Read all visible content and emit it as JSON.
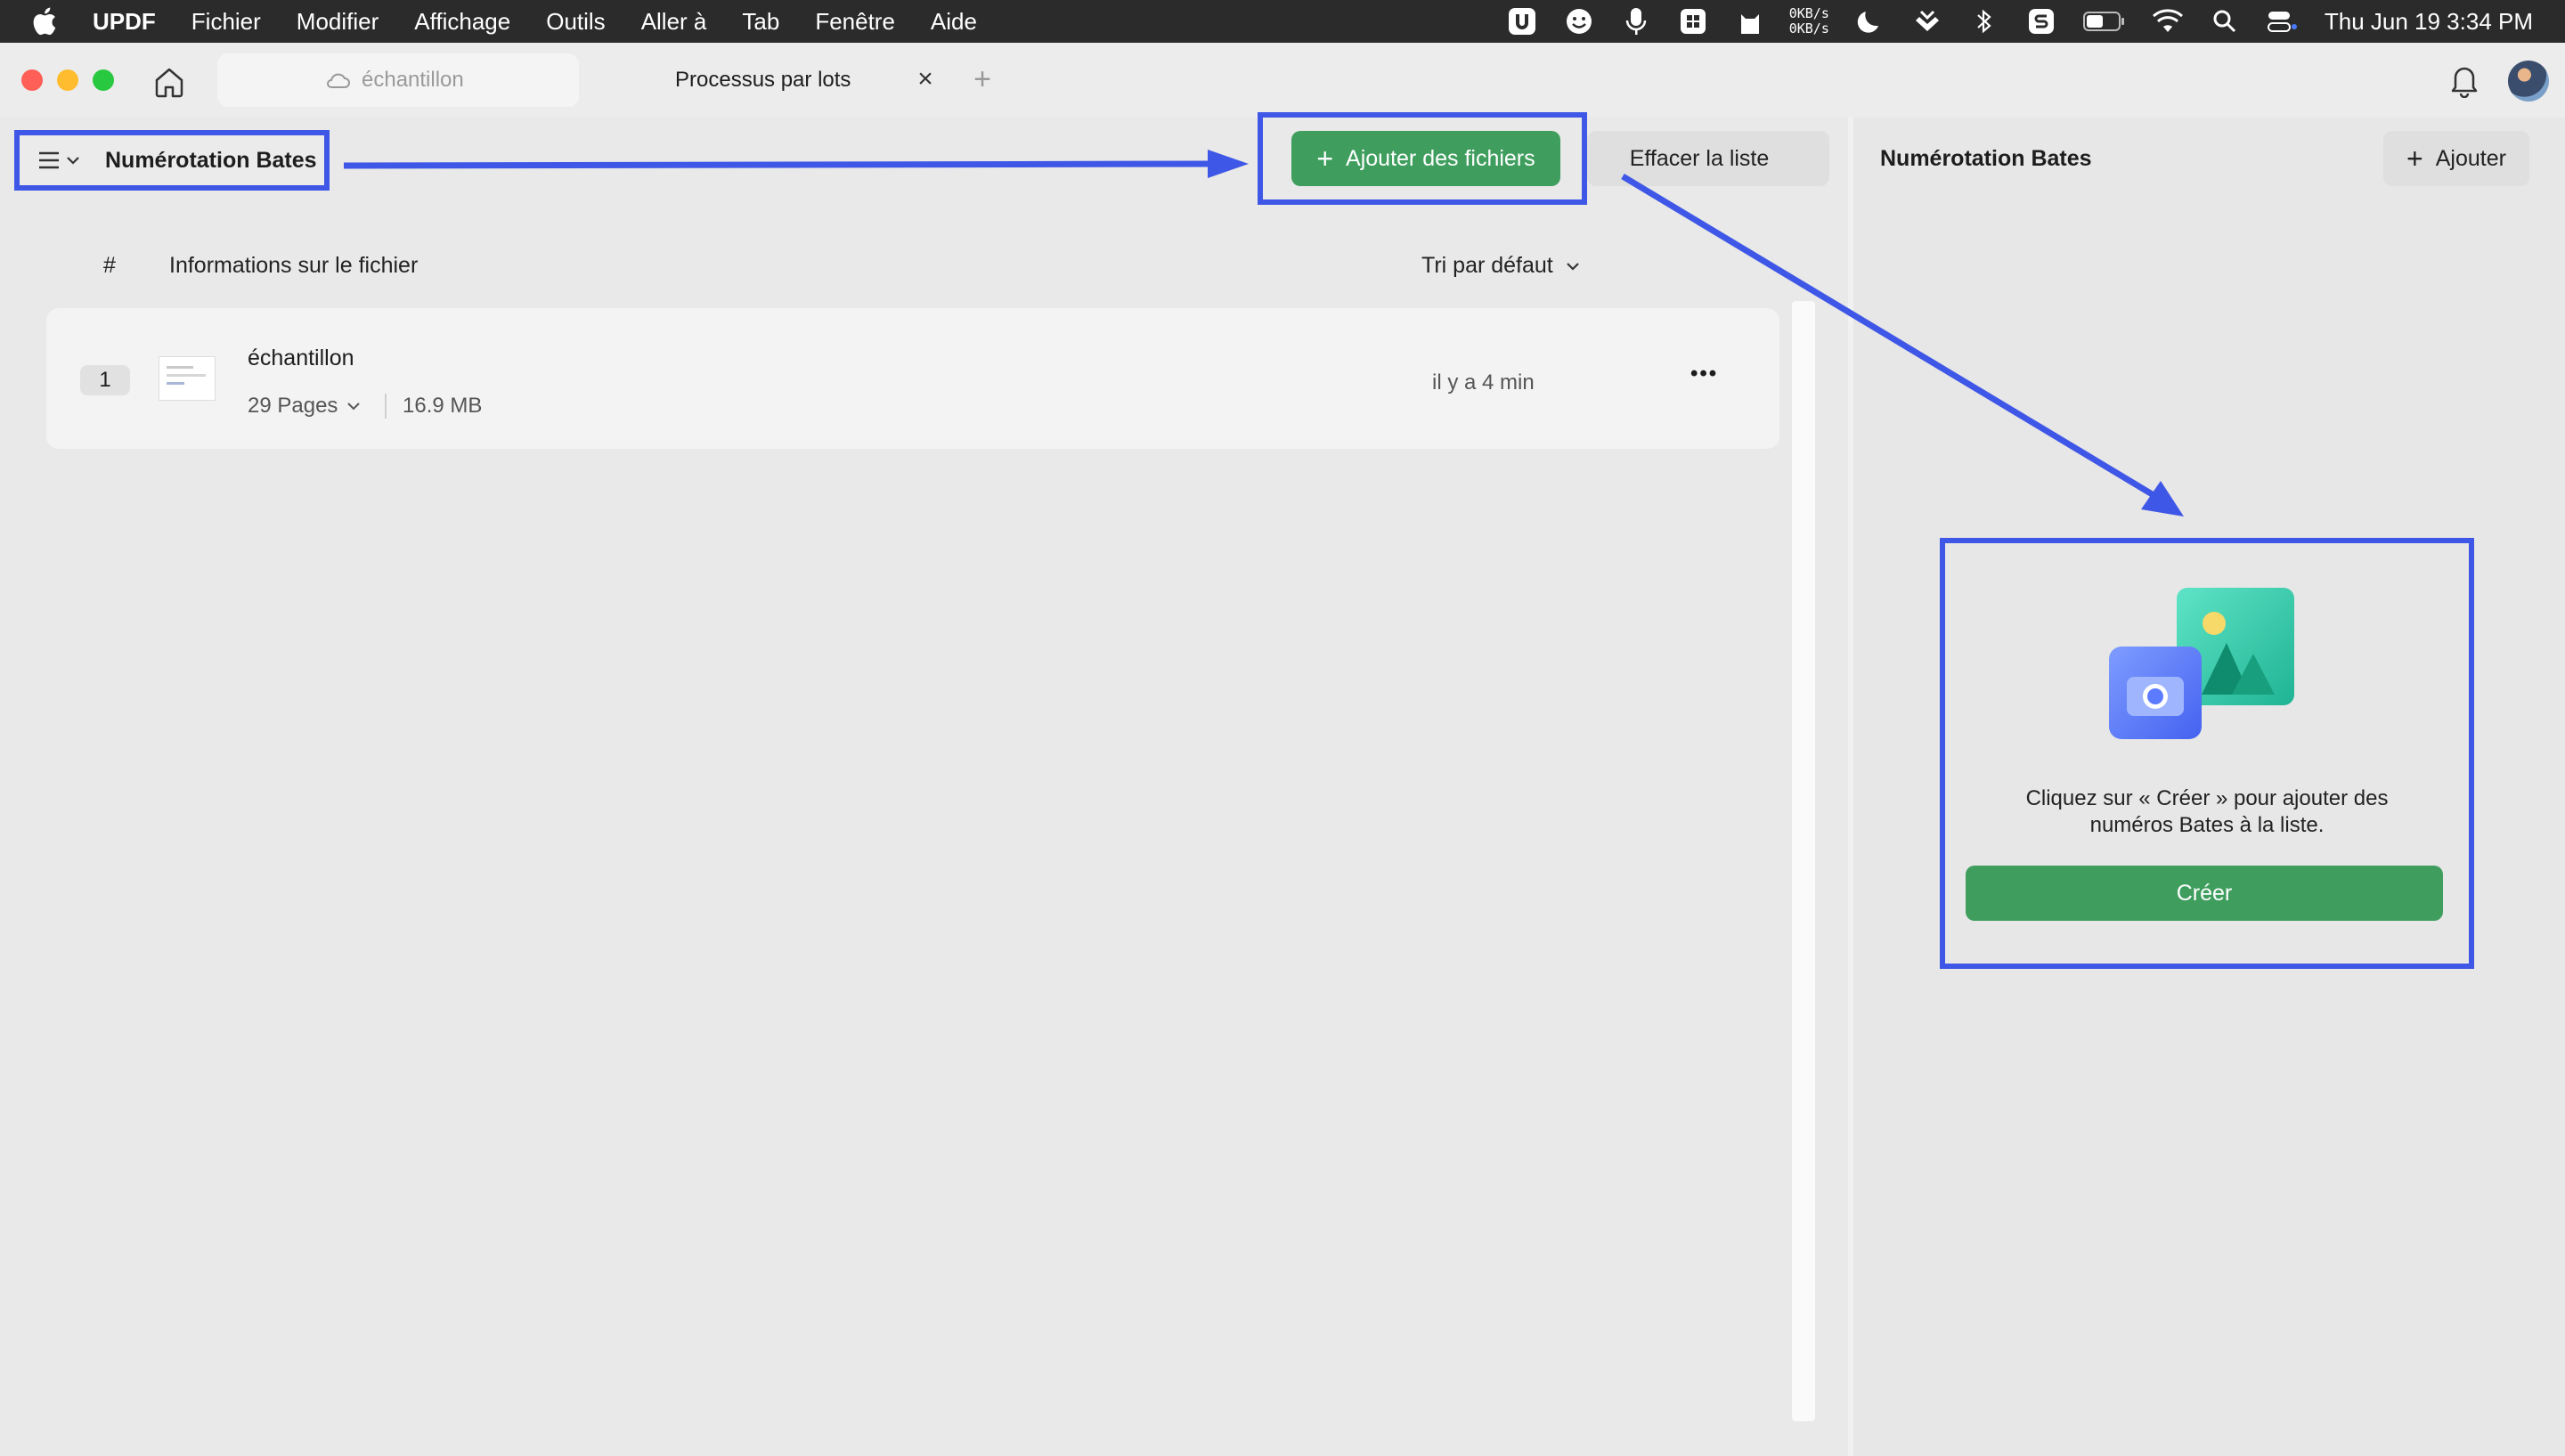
{
  "menubar": {
    "app_name": "UPDF",
    "items": [
      "Fichier",
      "Modifier",
      "Affichage",
      "Outils",
      "Aller à",
      "Tab",
      "Fenêtre",
      "Aide"
    ],
    "net_up": "0KB/s",
    "net_down": "0KB/s",
    "clock": "Thu Jun 19  3:34 PM"
  },
  "tabs": {
    "inactive_label": "échantillon",
    "active_label": "Processus par lots",
    "close_symbol": "×",
    "new_symbol": "+"
  },
  "toolbar": {
    "mode_label": "Numérotation Bates",
    "add_files_label": "Ajouter des fichiers",
    "clear_list_label": "Effacer la liste"
  },
  "file_list": {
    "col_index": "#",
    "col_info": "Informations sur le fichier",
    "sort_label": "Tri par défaut",
    "files": [
      {
        "index": "1",
        "name": "échantillon",
        "pages": "29 Pages",
        "size": "16.9 MB",
        "time": "il y a 4 min",
        "menu": "•••"
      }
    ]
  },
  "right_panel": {
    "title": "Numérotation Bates",
    "add_label": "Ajouter",
    "empty_line1": "Cliquez sur « Créer » pour ajouter des",
    "empty_line2": "numéros Bates à la liste.",
    "create_label": "Créer"
  },
  "colors": {
    "accent_green": "#3f9e5e",
    "annotation_blue": "#3f57e6"
  }
}
